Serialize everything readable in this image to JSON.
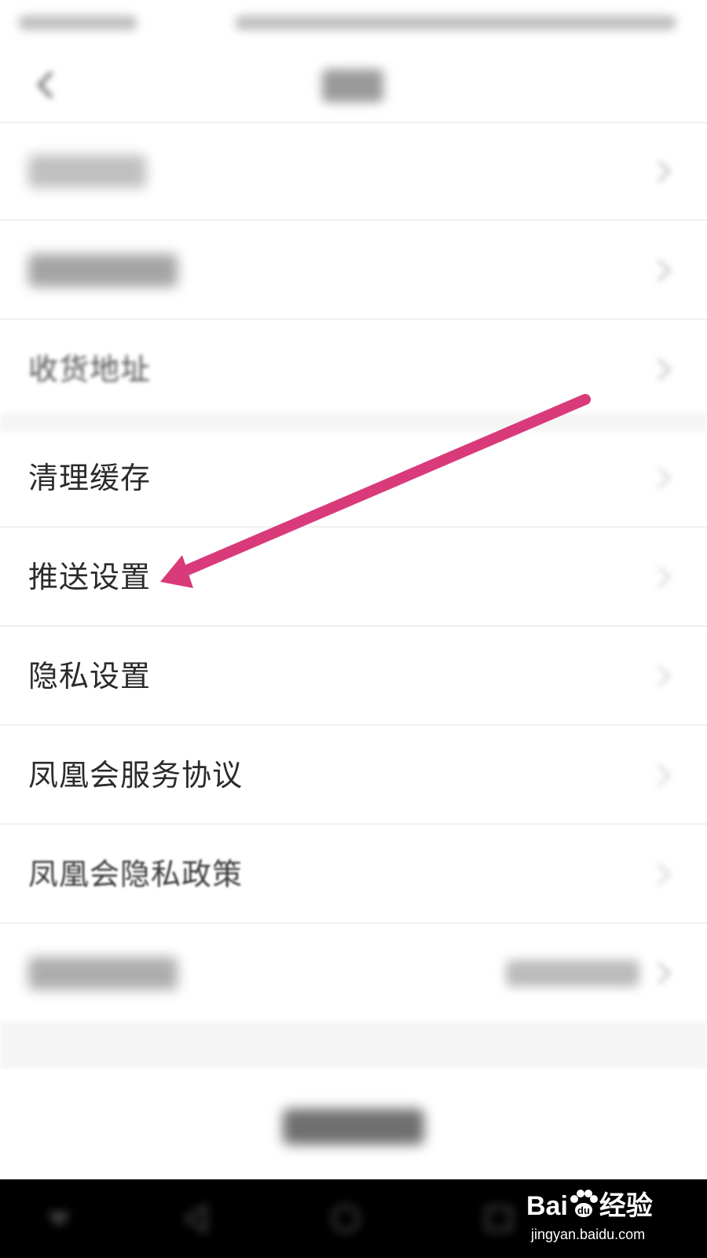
{
  "settings": {
    "items": [
      {
        "label": "收货地址"
      },
      {
        "label": "清理缓存"
      },
      {
        "label": "推送设置"
      },
      {
        "label": "隐私设置"
      },
      {
        "label": "凤凰会服务协议"
      },
      {
        "label": "凤凰会隐私政策"
      }
    ]
  },
  "watermark": {
    "brand_left": "Bai",
    "brand_right": "经验",
    "url": "jingyan.baidu.com"
  },
  "colors": {
    "annotation_arrow": "#d93a7a",
    "bottom_nav": "#000000"
  },
  "icons": [
    "back-arrow-icon",
    "chevron-right-icon",
    "paw-icon"
  ]
}
